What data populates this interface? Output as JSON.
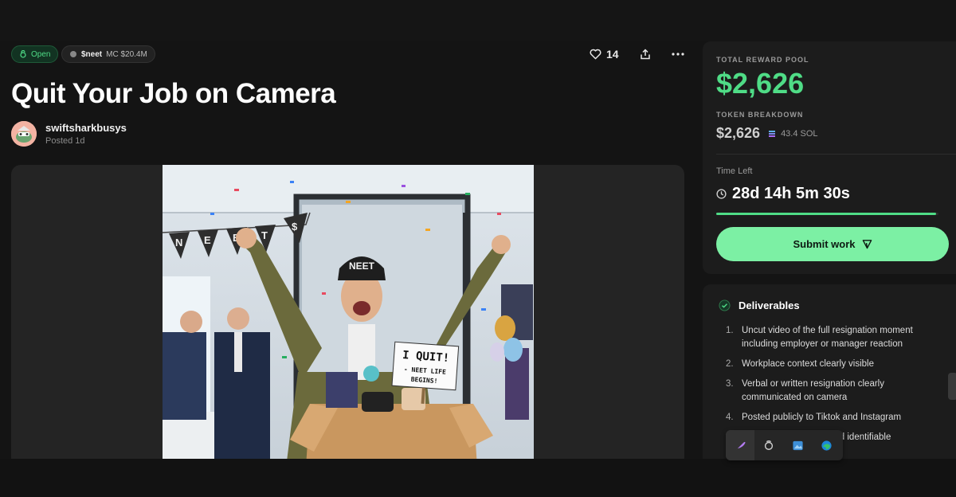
{
  "header": {
    "status_badge": "Open",
    "token_symbol": "$neet",
    "token_mc": "MC $20.4M",
    "likes": "14",
    "title": "Quit Your Job on Camera"
  },
  "author": {
    "username": "swiftsharkbusys",
    "posted": "Posted 1d"
  },
  "media": {
    "sign_line1": "I QUIT!",
    "sign_line2": "- NEET LIFE",
    "sign_line3": "BEGINS!",
    "cap_text": "NEET",
    "banner_letters": [
      "N",
      "E",
      "E",
      "T",
      "$"
    ]
  },
  "reward": {
    "pool_label": "TOTAL REWARD POOL",
    "pool_amount": "$2,626",
    "breakdown_label": "TOKEN BREAKDOWN",
    "breakdown_usd": "$2,626",
    "breakdown_sol": "43.4 SOL",
    "time_left_label": "Time Left",
    "countdown": "28d 14h 5m 30s",
    "progress_fraction": 0.99,
    "submit_label": "Submit work"
  },
  "deliverables": {
    "title": "Deliverables",
    "items": [
      {
        "num": "1.",
        "text": "Uncut video of the full resignation moment including employer or manager reaction"
      },
      {
        "num": "2.",
        "text": "Workplace context clearly visible"
      },
      {
        "num": "3.",
        "text": "Verbal or written resignation clearly communicated on camera"
      },
      {
        "num": "4.",
        "text": "Posted publicly to Tiktok and Instagram"
      },
      {
        "num": "",
        "text": "and identifiable"
      }
    ]
  },
  "floating_toolbar": {
    "icons": [
      "feather-icon",
      "ring-icon",
      "image-icon",
      "edge-icon"
    ]
  },
  "colors": {
    "accent": "#4fdc86",
    "button": "#7cf0a4",
    "background": "#141414",
    "card": "#1c1c1c"
  }
}
